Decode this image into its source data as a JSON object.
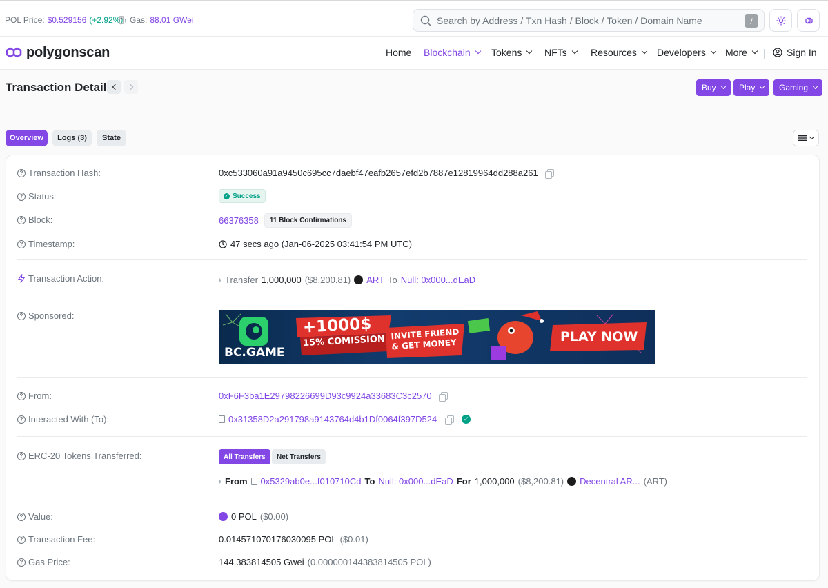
{
  "topbar": {
    "price_label": "POL Price:",
    "price_value": "$0.529156",
    "price_change": "(+2.92%)",
    "gas_label": "Gas:",
    "gas_value": "88.01 GWei",
    "search_placeholder": "Search by Address / Txn Hash / Block / Token / Domain Name",
    "search_shortcut": "/"
  },
  "header": {
    "logo_text": "polygonscan",
    "nav": [
      {
        "label": "Home"
      },
      {
        "label": "Blockchain"
      },
      {
        "label": "Tokens"
      },
      {
        "label": "NFTs"
      },
      {
        "label": "Resources"
      },
      {
        "label": "Developers"
      },
      {
        "label": "More"
      }
    ],
    "sign_in": "Sign In"
  },
  "page": {
    "title": "Transaction Details",
    "actions": [
      "Buy",
      "Play",
      "Gaming"
    ]
  },
  "tabs": [
    "Overview",
    "Logs (3)",
    "State"
  ],
  "details": {
    "hash_label": "Transaction Hash:",
    "hash_value": "0xc533060a91a9450c695cc7daebf47eafb2657efd2b7887e12819964dd288a261",
    "status_label": "Status:",
    "status_value": "Success",
    "block_label": "Block:",
    "block_value": "66376358",
    "block_confirmations": "11 Block Confirmations",
    "timestamp_label": "Timestamp:",
    "timestamp_value": "47 secs ago (Jan-06-2025 03:41:54 PM UTC)",
    "action_label": "Transaction Action:",
    "action_verb": "Transfer",
    "action_amount": "1,000,000",
    "action_usd": "($8,200.81)",
    "action_token": "ART",
    "action_to": "To",
    "action_dest": "Null: 0x000...dEaD",
    "sponsored_label": "Sponsored:",
    "banner": {
      "brand": "BC.GAME",
      "headline": "+1000$",
      "sub": "15% COMISSION",
      "invite": "INVITE FRIEND & GET MONEY",
      "cta": "PLAY NOW"
    },
    "from_label": "From:",
    "from_value": "0xF6F3ba1E29798226699D93c9924a33683C3c2570",
    "to_label": "Interacted With (To):",
    "to_value": "0x31358D2a291798a9143764d4b1Df0064f397D524",
    "erc20_label": "ERC-20 Tokens Transferred:",
    "erc20_tabs": [
      "All Transfers",
      "Net Transfers"
    ],
    "erc20_from_word": "From",
    "erc20_from": "0x5329ab0e...f010710Cd",
    "erc20_to_word": "To",
    "erc20_to": "Null: 0x000...dEaD",
    "erc20_for_word": "For",
    "erc20_amount": "1,000,000",
    "erc20_usd": "($8,200.81)",
    "erc20_token": "Decentral AR...",
    "erc20_symbol": "(ART)",
    "value_label": "Value:",
    "value_value": "0 POL",
    "value_usd": "($0.00)",
    "fee_label": "Transaction Fee:",
    "fee_value": "0.014571070176030095 POL",
    "fee_usd": "($0.01)",
    "gasprice_label": "Gas Price:",
    "gasprice_value": "144.383814505 Gwei",
    "gasprice_pol": "(0.000000144383814505 POL)"
  },
  "colors": {
    "accent": "#8247e5",
    "success": "#00a186"
  }
}
